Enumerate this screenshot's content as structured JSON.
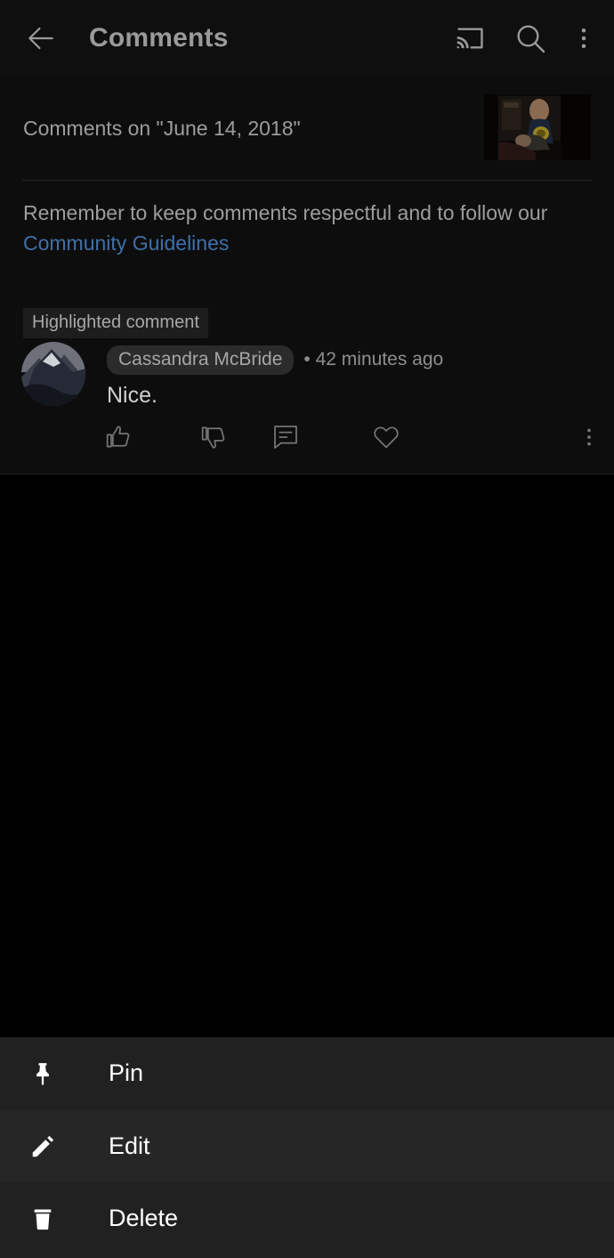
{
  "app": {
    "title": "Comments"
  },
  "appbar": {
    "back_icon": "back-arrow-icon",
    "cast_icon": "cast-icon",
    "search_icon": "search-icon",
    "overflow_icon": "overflow-menu-icon"
  },
  "video_header": {
    "title": "Comments on \"June 14, 2018\"",
    "thumbnail_alt": "video-thumbnail"
  },
  "guidelines": {
    "text": "Remember to keep comments respectful and to follow our",
    "link_label": "Community Guidelines",
    "link_color": "#3f6fa8"
  },
  "comment": {
    "badge": "Highlighted comment",
    "author": "Cassandra McBride",
    "timestamp": "• 42 minutes ago",
    "text": "Nice.",
    "avatar_alt": "user-avatar",
    "actions": [
      {
        "name": "like-icon",
        "label": "Like"
      },
      {
        "name": "dislike-icon",
        "label": "Dislike"
      },
      {
        "name": "reply-icon",
        "label": "Reply"
      },
      {
        "name": "heart-icon",
        "label": "Heart"
      },
      {
        "name": "comment-overflow-icon",
        "label": "More"
      }
    ]
  },
  "bottom_sheet": {
    "items": [
      {
        "label": "Pin",
        "icon": "pin-icon",
        "selected": false
      },
      {
        "label": "Edit",
        "icon": "pencil-icon",
        "selected": true
      },
      {
        "label": "Delete",
        "icon": "trash-icon",
        "selected": false
      }
    ]
  },
  "annotation": {
    "highlight_color": "#fa1155",
    "target": "Edit"
  }
}
